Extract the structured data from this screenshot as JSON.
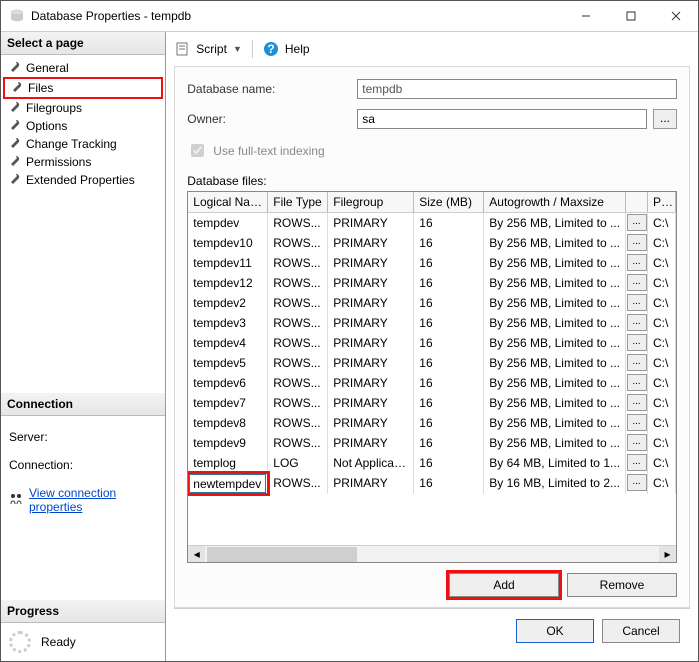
{
  "window": {
    "title": "Database Properties - tempdb"
  },
  "sidebar": {
    "select_hdr": "Select a page",
    "connection_hdr": "Connection",
    "progress_hdr": "Progress",
    "pages": [
      {
        "label": "General"
      },
      {
        "label": "Files"
      },
      {
        "label": "Filegroups"
      },
      {
        "label": "Options"
      },
      {
        "label": "Change Tracking"
      },
      {
        "label": "Permissions"
      },
      {
        "label": "Extended Properties"
      }
    ],
    "server_lbl": "Server:",
    "conn_lbl": "Connection:",
    "view_conn": "View connection properties",
    "ready": "Ready"
  },
  "toolbar": {
    "script": "Script",
    "help": "Help"
  },
  "form": {
    "dbname_lbl": "Database name:",
    "dbname_val": "tempdb",
    "owner_lbl": "Owner:",
    "owner_val": "sa",
    "owner_ell": "...",
    "fulltext": "Use full-text indexing",
    "files_lbl": "Database files:",
    "cols": {
      "ln": "Logical Name",
      "ft": "File Type",
      "fg": "Filegroup",
      "sz": "Size (MB)",
      "ag": "Autogrowth / Maxsize",
      "pth": "Path"
    },
    "rows": [
      {
        "ln": "tempdev",
        "ft": "ROWS...",
        "fg": "PRIMARY",
        "sz": "16",
        "ag": "By 256 MB, Limited to ...",
        "pth": "C:\\"
      },
      {
        "ln": "tempdev10",
        "ft": "ROWS...",
        "fg": "PRIMARY",
        "sz": "16",
        "ag": "By 256 MB, Limited to ...",
        "pth": "C:\\"
      },
      {
        "ln": "tempdev11",
        "ft": "ROWS...",
        "fg": "PRIMARY",
        "sz": "16",
        "ag": "By 256 MB, Limited to ...",
        "pth": "C:\\"
      },
      {
        "ln": "tempdev12",
        "ft": "ROWS...",
        "fg": "PRIMARY",
        "sz": "16",
        "ag": "By 256 MB, Limited to ...",
        "pth": "C:\\"
      },
      {
        "ln": "tempdev2",
        "ft": "ROWS...",
        "fg": "PRIMARY",
        "sz": "16",
        "ag": "By 256 MB, Limited to ...",
        "pth": "C:\\"
      },
      {
        "ln": "tempdev3",
        "ft": "ROWS...",
        "fg": "PRIMARY",
        "sz": "16",
        "ag": "By 256 MB, Limited to ...",
        "pth": "C:\\"
      },
      {
        "ln": "tempdev4",
        "ft": "ROWS...",
        "fg": "PRIMARY",
        "sz": "16",
        "ag": "By 256 MB, Limited to ...",
        "pth": "C:\\"
      },
      {
        "ln": "tempdev5",
        "ft": "ROWS...",
        "fg": "PRIMARY",
        "sz": "16",
        "ag": "By 256 MB, Limited to ...",
        "pth": "C:\\"
      },
      {
        "ln": "tempdev6",
        "ft": "ROWS...",
        "fg": "PRIMARY",
        "sz": "16",
        "ag": "By 256 MB, Limited to ...",
        "pth": "C:\\"
      },
      {
        "ln": "tempdev7",
        "ft": "ROWS...",
        "fg": "PRIMARY",
        "sz": "16",
        "ag": "By 256 MB, Limited to ...",
        "pth": "C:\\"
      },
      {
        "ln": "tempdev8",
        "ft": "ROWS...",
        "fg": "PRIMARY",
        "sz": "16",
        "ag": "By 256 MB, Limited to ...",
        "pth": "C:\\"
      },
      {
        "ln": "tempdev9",
        "ft": "ROWS...",
        "fg": "PRIMARY",
        "sz": "16",
        "ag": "By 256 MB, Limited to ...",
        "pth": "C:\\"
      },
      {
        "ln": "templog",
        "ft": "LOG",
        "fg": "Not Applicable",
        "sz": "16",
        "ag": "By 64 MB, Limited to 1...",
        "pth": "C:\\"
      },
      {
        "ln": "newtempdev",
        "ft": "ROWS...",
        "fg": "PRIMARY",
        "sz": "16",
        "ag": "By 16 MB, Limited to 2...",
        "pth": "C:\\",
        "editing": true
      }
    ],
    "ell": "..."
  },
  "buttons": {
    "add": "Add",
    "remove": "Remove",
    "ok": "OK",
    "cancel": "Cancel"
  }
}
